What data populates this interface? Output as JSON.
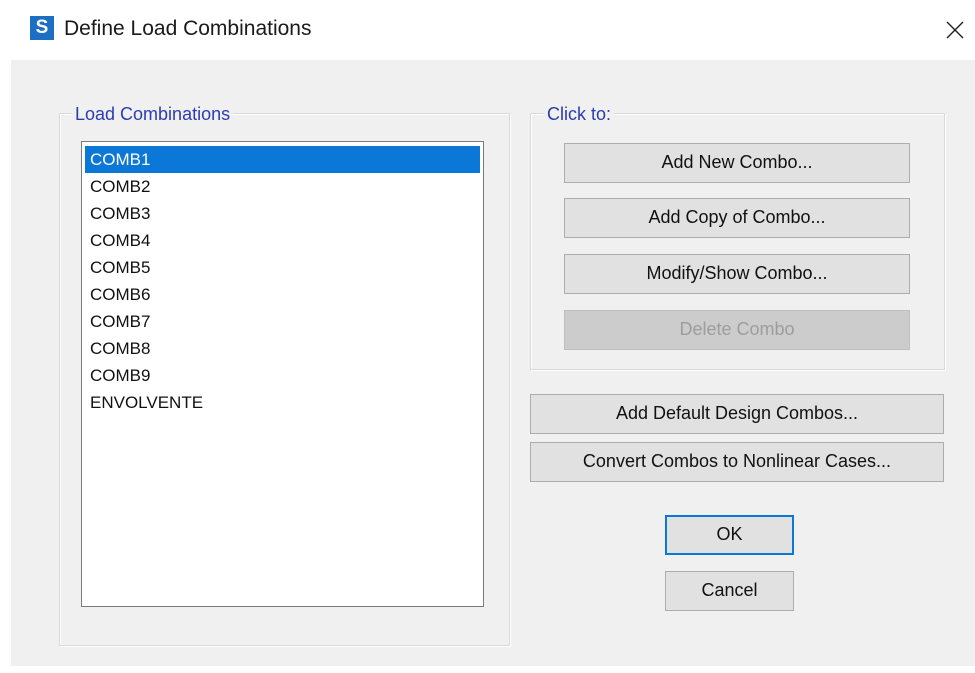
{
  "window": {
    "title": "Define Load Combinations",
    "icon_letter": "S",
    "icon_color": "#1d6fc4"
  },
  "load_combinations": {
    "label": "Load Combinations",
    "items": [
      "COMB1",
      "COMB2",
      "COMB3",
      "COMB4",
      "COMB5",
      "COMB6",
      "COMB7",
      "COMB8",
      "COMB9",
      "ENVOLVENTE"
    ],
    "selected": "COMB1"
  },
  "click_to": {
    "label": "Click to:",
    "add_new": "Add New Combo...",
    "add_copy": "Add Copy of Combo...",
    "modify_show": "Modify/Show Combo...",
    "delete": "Delete Combo"
  },
  "actions": {
    "add_default": "Add Default Design Combos...",
    "convert": "Convert Combos to Nonlinear Cases...",
    "ok": "OK",
    "cancel": "Cancel"
  },
  "colors": {
    "selection": "#0b78d7",
    "group_label": "#2a3cb0",
    "dialog_bg": "#f0f0f0"
  }
}
